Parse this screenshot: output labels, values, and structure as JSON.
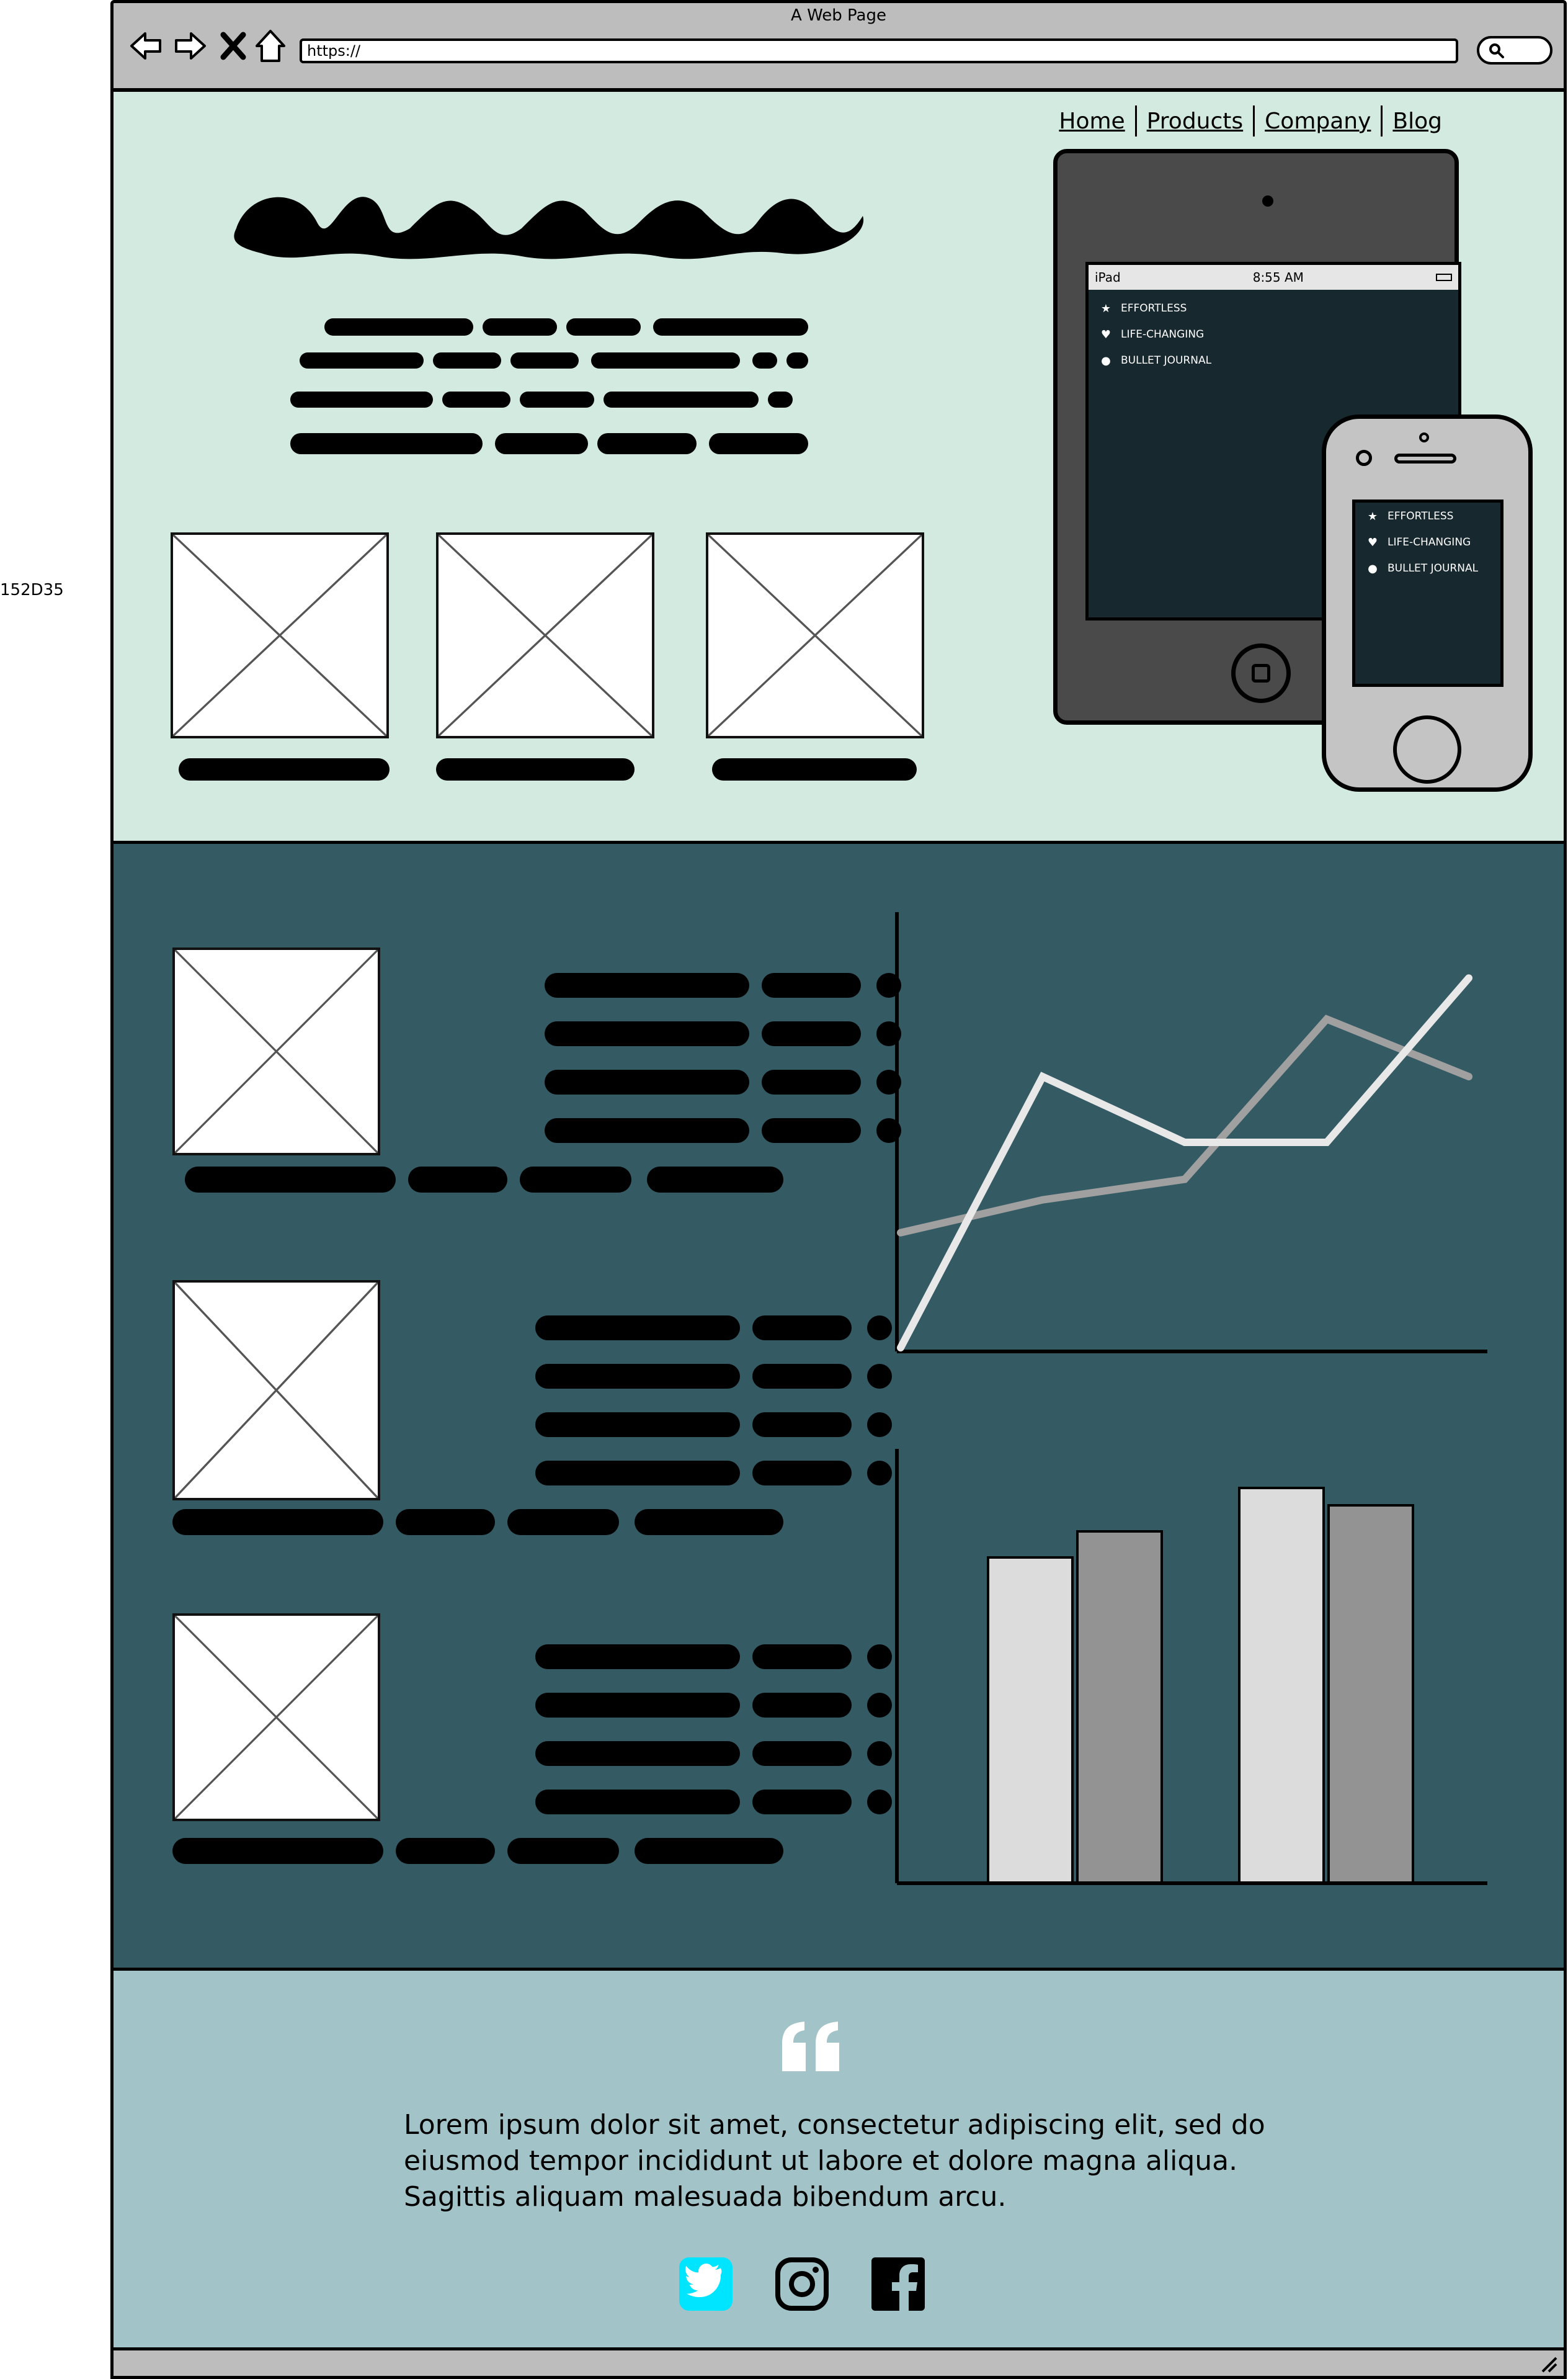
{
  "side_label": "152D35",
  "browser": {
    "window_title": "A Web Page",
    "url": "https://",
    "icons": [
      "back-icon",
      "forward-icon",
      "close-icon",
      "home-icon",
      "search-icon"
    ]
  },
  "nav": {
    "links": [
      "Home",
      "Products",
      "Company",
      "Blog"
    ]
  },
  "devices": {
    "ipad": {
      "carrier": "iPad",
      "time": "8:55 AM",
      "items": [
        {
          "icon": "star-icon",
          "label": "EFFORTLESS"
        },
        {
          "icon": "heart-icon",
          "label": "LIFE-CHANGING"
        },
        {
          "icon": "circle-icon",
          "label": "BULLET JOURNAL"
        }
      ]
    },
    "iphone": {
      "items": [
        {
          "icon": "star-icon",
          "label": "EFFORTLESS"
        },
        {
          "icon": "heart-icon",
          "label": "LIFE-CHANGING"
        },
        {
          "icon": "circle-icon",
          "label": "BULLET JOURNAL"
        }
      ]
    }
  },
  "colors": {
    "hero_bg": "#d2eadf",
    "features_bg": "#345a64",
    "quote_bg": "#a2c3c7",
    "chrome": "#bdbdbd",
    "device_screen": "#17282f",
    "twitter_accent": "#00e5ff"
  },
  "quote": {
    "icon": "quote-icon",
    "text": " Lorem ipsum dolor sit amet, consectetur adipiscing elit, sed do eiusmod tempor incididunt ut labore et dolore magna aliqua. Sagittis aliquam malesuada bibendum arcu.",
    "social_icons": [
      "twitter-icon",
      "instagram-icon",
      "facebook-icon"
    ]
  },
  "chart_data": [
    {
      "type": "line",
      "x": [
        0,
        1,
        2,
        3,
        4
      ],
      "series": [
        {
          "values": [
            0,
            6.6,
            5.0,
            5.0,
            9.0
          ],
          "color": "#e8e8e8"
        },
        {
          "values": [
            2.8,
            3.6,
            4.1,
            8.0,
            6.6
          ],
          "color": "#a0a0a0"
        }
      ],
      "ylim": [
        0,
        10
      ],
      "grid": false,
      "note_points": "first series peaks at x=1, dips at x=3; second series rises to peak at x=3"
    },
    {
      "type": "bar",
      "categories": [
        "",
        ""
      ],
      "series": [
        {
          "values": [
            7.5,
            9.1
          ],
          "color": "#dcdcdc"
        },
        {
          "values": [
            8.1,
            8.7
          ],
          "color": "#939393"
        }
      ],
      "ylim": [
        0,
        10
      ],
      "grid": false
    }
  ]
}
